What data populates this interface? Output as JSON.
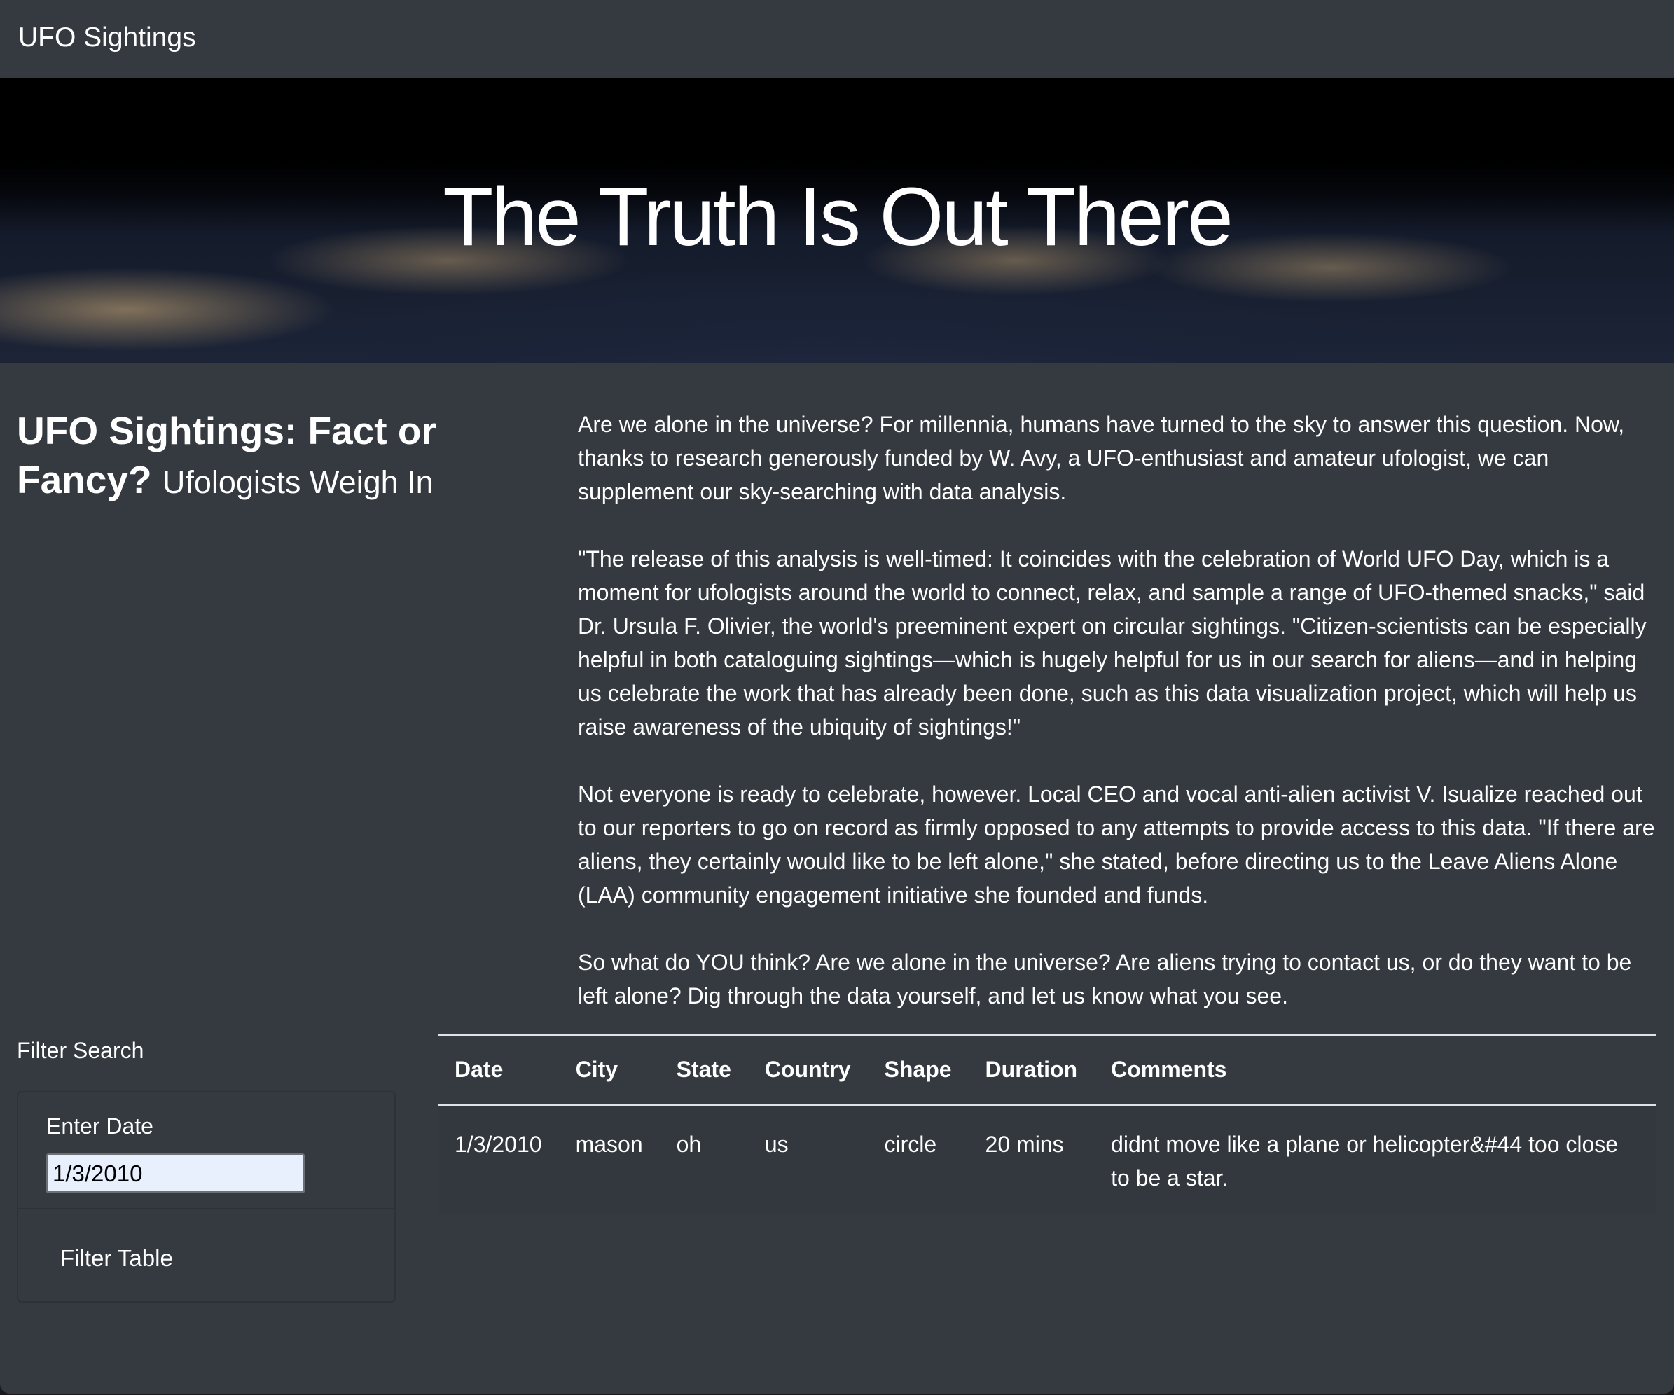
{
  "nav": {
    "brand": "UFO Sightings"
  },
  "hero": {
    "title": "The Truth Is Out There"
  },
  "heading": {
    "main": "UFO Sightings: Fact or Fancy?",
    "sub": "Ufologists Weigh In"
  },
  "article": {
    "paragraphs": [
      "Are we alone in the universe? For millennia, humans have turned to the sky to answer this question. Now, thanks to research generously funded by W. Avy, a UFO-enthusiast and amateur ufologist, we can supplement our sky-searching with data analysis.",
      "\"The release of this analysis is well-timed: It coincides with the celebration of World UFO Day, which is a moment for ufologists around the world to connect, relax, and sample a range of UFO-themed snacks,\" said Dr. Ursula F. Olivier, the world's preeminent expert on circular sightings. \"Citizen-scientists can be especially helpful in both cataloguing sightings—which is hugely helpful for us in our search for aliens—and in helping us celebrate the work that has already been done, such as this data visualization project, which will help us raise awareness of the ubiquity of sightings!\"",
      "Not everyone is ready to celebrate, however. Local CEO and vocal anti-alien activist V. Isualize reached out to our reporters to go on record as firmly opposed to any attempts to provide access to this data. \"If there are aliens, they certainly would like to be left alone,\" she stated, before directing us to the Leave Aliens Alone (LAA) community engagement initiative she founded and funds.",
      "So what do YOU think? Are we alone in the universe? Are aliens trying to contact us, or do they want to be left alone? Dig through the data yourself, and let us know what you see."
    ]
  },
  "filter": {
    "title": "Filter Search",
    "date_label": "Enter Date",
    "date_value": "1/3/2010",
    "button": "Filter Table"
  },
  "table": {
    "headers": [
      "Date",
      "City",
      "State",
      "Country",
      "Shape",
      "Duration",
      "Comments"
    ],
    "rows": [
      [
        "1/3/2010",
        "mason",
        "oh",
        "us",
        "circle",
        "20 mins",
        "didnt move like a plane or helicopter&#44 too close to be a star."
      ]
    ]
  }
}
